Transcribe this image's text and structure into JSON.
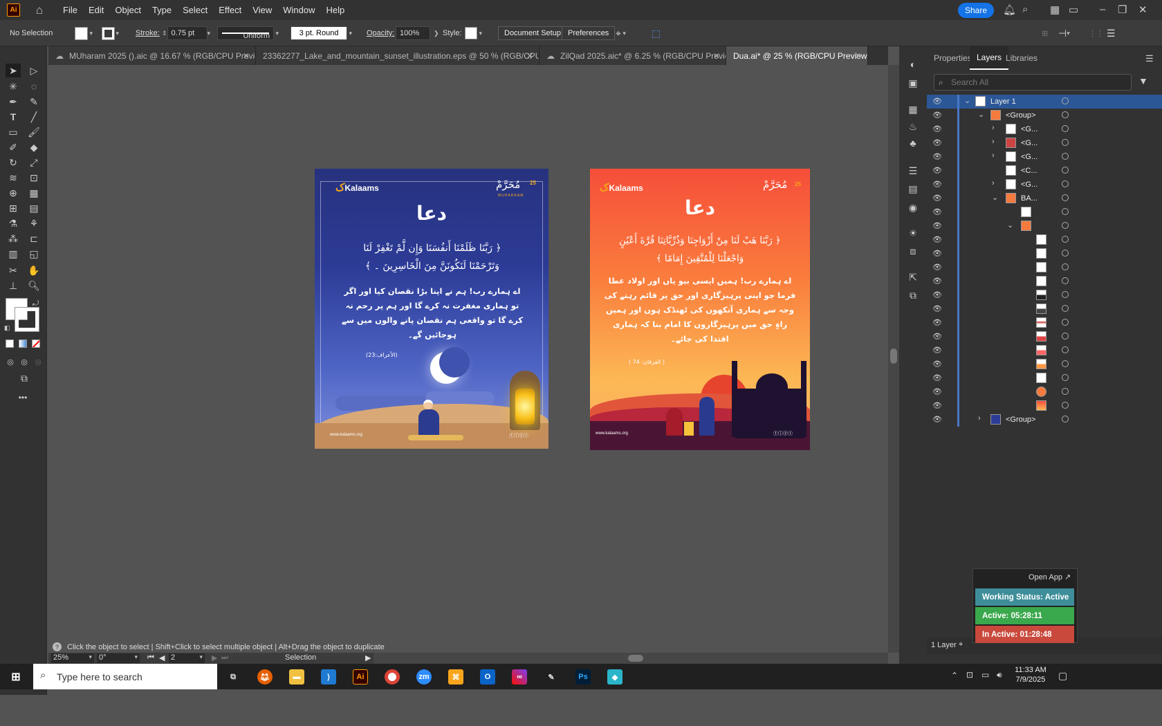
{
  "menubar": {
    "app_icon": "Ai",
    "items": [
      "File",
      "Edit",
      "Object",
      "Type",
      "Select",
      "Effect",
      "View",
      "Window",
      "Help"
    ],
    "share_label": "Share"
  },
  "control": {
    "selection": "No Selection",
    "stroke_label": "Stroke:",
    "stroke_value": "0.75 pt",
    "profile": "Uniform",
    "brush": "3 pt. Round",
    "opacity_label": "Opacity:",
    "opacity_value": "100%",
    "style_label": "Style:",
    "doc_setup": "Document Setup",
    "preferences": "Preferences"
  },
  "tabs": [
    {
      "label": "MUharam 2025 ().aic @ 16.67 % (RGB/CPU Previe...",
      "active": false
    },
    {
      "label": "23362277_Lake_and_mountain_sunset_illustration.eps @ 50 % (RGB/CPU Pr...",
      "active": false
    },
    {
      "label": "ZilQad 2025.aic* @ 6.25 % (RGB/CPU Previe...",
      "active": false
    },
    {
      "label": "Dua.ai* @ 25 % (RGB/CPU Preview)",
      "active": true
    }
  ],
  "artboard1": {
    "brand": "Kalaams",
    "month": "مُحَرَّمْ",
    "month_num": "25",
    "month_en": "MUHARRAM",
    "title": "دعا",
    "verse1": "﴿ رَبَّنَا ظَلَمْنَا أَنفُسَنَا وَإِن لَّمْ تَغْفِرْ لَنَا",
    "verse2": "وَتَرْحَمْنَا لَنَكُونَنَّ مِنَ الْخَاسِرِينَ ۔ ﴾",
    "trans1": "اے ہمارے رب! ہم نے اپنا بڑا نقصان کیا اور اگر",
    "trans2": "تو ہماری مغفرت نہ کرے گا اور ہم پر رحم نہ",
    "trans3": "کرے گا تو واقعی ہم نقصان پانے والوں میں سے",
    "trans4": "ہوجائیں گے۔",
    "reference": "(الأعراف:23)",
    "website": "www.kalaams.org"
  },
  "artboard2": {
    "brand": "Kalaams",
    "month": "مُحَرَّمْ",
    "month_num": "25",
    "title": "دعا",
    "verse1": "﴿ رَبَّنَا هَبْ لَنَا مِنْ أَزْوَاجِنَا وَذُرِّيَّاتِنَا قُرَّةَ أَعْيُنٍ",
    "verse2": "وَاجْعَلْنَا لِلْمُتَّقِينَ إِمَامًا ﴾",
    "trans1": "اے ہمارے رب! ہمیں ایسی بیو یاں اور اولاد عطا",
    "trans2": "فرما جو اپنی پرہیزگاری اور حق پر قائم رہنے کی",
    "trans3": "وجہ سے ہماری آنکھوں کی ٹھنڈک ہوں اور ہمیں",
    "trans4": "راہِ حق میں پرہیزگاروں کا امام بنا کہ ہماری",
    "trans5": "اقتدا کی جائے۔",
    "reference": "( الفرقان: 74 )",
    "website": "www.kalaams.org"
  },
  "status": {
    "hint": "Click the object to select  |  Shift+Click to select multiple object  |  Alt+Drag the object to duplicate",
    "zoom": "25%",
    "rotation": "0°",
    "artboard_num": "2",
    "tool": "Selection"
  },
  "panel": {
    "tabs": [
      "Properties",
      "Layers",
      "Libraries"
    ],
    "search_placeholder": "Search All",
    "layer1": "Layer 1",
    "group": "<Group>",
    "g": "<G...",
    "c": "<C...",
    "ba": "BA...",
    "footer": "1 Layer"
  },
  "widget": {
    "open_app": "Open App ↗",
    "working": "Working Status: Active",
    "active": "Active: 05:28:11",
    "inactive": "In Active: 01:28:48"
  },
  "taskbar": {
    "search_placeholder": "Type here to search",
    "time": "11:33 AM",
    "date": "7/9/2025"
  }
}
